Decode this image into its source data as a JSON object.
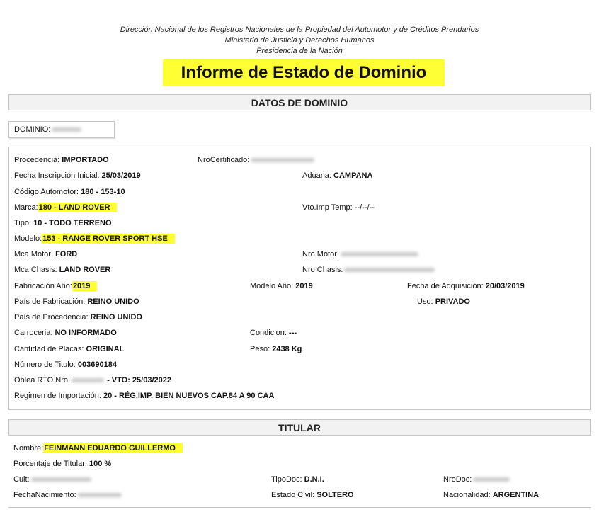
{
  "header": {
    "line1": "Dirección Nacional de los Registros Nacionales de la Propiedad del Automotor y de Créditos Prendarios",
    "line2": "Ministerio de Justicia y Derechos Humanos",
    "line3": "Presidencia de la Nación",
    "title": "Informe de Estado de Dominio"
  },
  "sections": {
    "dominio": "DATOS DE DOMINIO",
    "titular": "TITULAR"
  },
  "dominio_label": "DOMINIO:",
  "vehicle": {
    "procedencia_label": "Procedencia:",
    "procedencia": "IMPORTADO",
    "nrocert_label": "NroCertificado:",
    "fecha_insc_label": "Fecha Inscripción Inicial:",
    "fecha_insc": "25/03/2019",
    "aduana_label": "Aduana:",
    "aduana": "CAMPANA",
    "codigo_label": "Código Automotor:",
    "codigo": "180 - 153-10",
    "marca_label": "Marca:",
    "marca": "180 - LAND ROVER",
    "vto_label": "Vto.Imp Temp:",
    "vto": "--/--/--",
    "tipo_label": "Tipo:",
    "tipo": "10 - TODO TERRENO",
    "modelo_label": "Modelo:",
    "modelo": "153 - RANGE ROVER SPORT HSE",
    "mca_motor_label": "Mca Motor:",
    "mca_motor": "FORD",
    "nro_motor_label": "Nro.Motor:",
    "mca_chasis_label": "Mca Chasis:",
    "mca_chasis": "LAND ROVER",
    "nro_chasis_label": "Nro Chasis:",
    "fab_anio_label": "Fabricación Año:",
    "fab_anio": "2019",
    "modelo_anio_label": "Modelo Año:",
    "modelo_anio": "2019",
    "fecha_adq_label": "Fecha de Adquisición:",
    "fecha_adq": "20/03/2019",
    "pais_fab_label": "País de Fabricación:",
    "pais_fab": "REINO UNIDO",
    "uso_label": "Uso:",
    "uso": "PRIVADO",
    "pais_proc_label": "País de Procedencia:",
    "pais_proc": "REINO UNIDO",
    "carroceria_label": "Carroceria:",
    "carroceria": "NO INFORMADO",
    "condicion_label": "Condicion:",
    "condicion": "---",
    "placas_label": "Cantidad de Placas:",
    "placas": "ORIGINAL",
    "peso_label": "Peso:",
    "peso": "2438 Kg",
    "titulo_label": "Número de Titulo:",
    "titulo": "003690184",
    "oblea_label": "Oblea RTO Nro:",
    "oblea_vto": "- VTO: 25/03/2022",
    "regimen_label": "Regimen de Importación:",
    "regimen": "20 - RÉG.IMP. BIEN NUEVOS CAP.84 A 90 CAA"
  },
  "titular": {
    "nombre_label": "Nombre:",
    "nombre": "FEINMANN EDUARDO GUILLERMO",
    "porcentaje_label": "Porcentaje de Titular:",
    "porcentaje": "100 %",
    "cuit_label": "Cuit:",
    "tipodoc_label": "TipoDoc:",
    "tipodoc": "D.N.I.",
    "nrodoc_label": "NroDoc:",
    "fnac_label": "FechaNacimiento:",
    "estado_civil_label": "Estado Civil:",
    "estado_civil": "SOLTERO",
    "nacionalidad_label": "Nacionalidad:",
    "nacionalidad": "ARGENTINA"
  },
  "colors": {
    "highlight": "#ffff33",
    "border": "#c4c4c4",
    "section_bg": "#f2f2f2"
  }
}
